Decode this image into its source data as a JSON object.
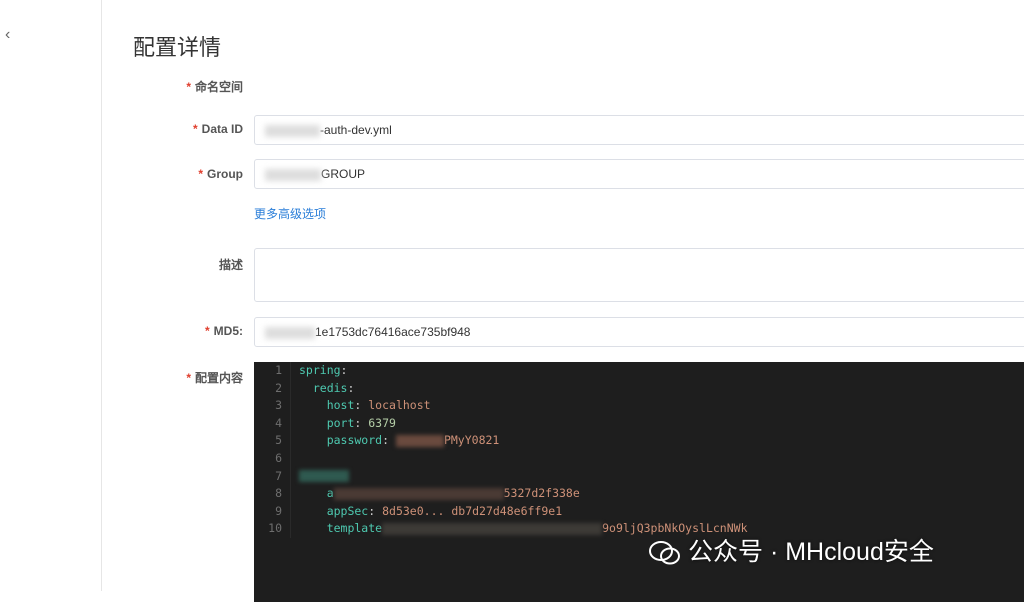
{
  "nav": {
    "back_icon": "chevron-left-icon"
  },
  "title": "配置详情",
  "form": {
    "namespace_label": "命名空间",
    "dataid_label": "Data ID",
    "dataid_value": "-auth-dev.yml",
    "group_label": "Group",
    "group_value": "GROUP",
    "advanced_link": "更多高级选项",
    "desc_label": "描述",
    "desc_value": "",
    "md5_label": "MD5:",
    "md5_value": "1e1753dc76416ace735bf948",
    "content_label": "配置内容",
    "required_mark": "*"
  },
  "editor": {
    "lines": [
      {
        "n": "1",
        "k": "spring",
        "sep": ":",
        "v": ""
      },
      {
        "n": "2",
        "k": "  redis",
        "sep": ":",
        "v": ""
      },
      {
        "n": "3",
        "k": "    host",
        "sep": ": ",
        "v": "localhost"
      },
      {
        "n": "4",
        "k": "    port",
        "sep": ": ",
        "v": "6379"
      },
      {
        "n": "5",
        "k": "    password",
        "sep": ": ",
        "v": "PMyY0821"
      },
      {
        "n": "6",
        "k": "",
        "sep": "",
        "v": ""
      },
      {
        "n": "7",
        "k": "",
        "sep": "",
        "v": ""
      },
      {
        "n": "8",
        "k": "    a",
        "sep": "",
        "v": "5327d2f338e"
      },
      {
        "n": "9",
        "k": "    appSec",
        "sep": ": ",
        "v": "8d53e0... db7d27d48e6ff9e1"
      },
      {
        "n": "10",
        "k": "    template",
        "sep": "",
        "v": "9o9ljQ3pbNkOyslLcnNWk"
      }
    ]
  },
  "watermark": "公众号 · MHcloud安全"
}
